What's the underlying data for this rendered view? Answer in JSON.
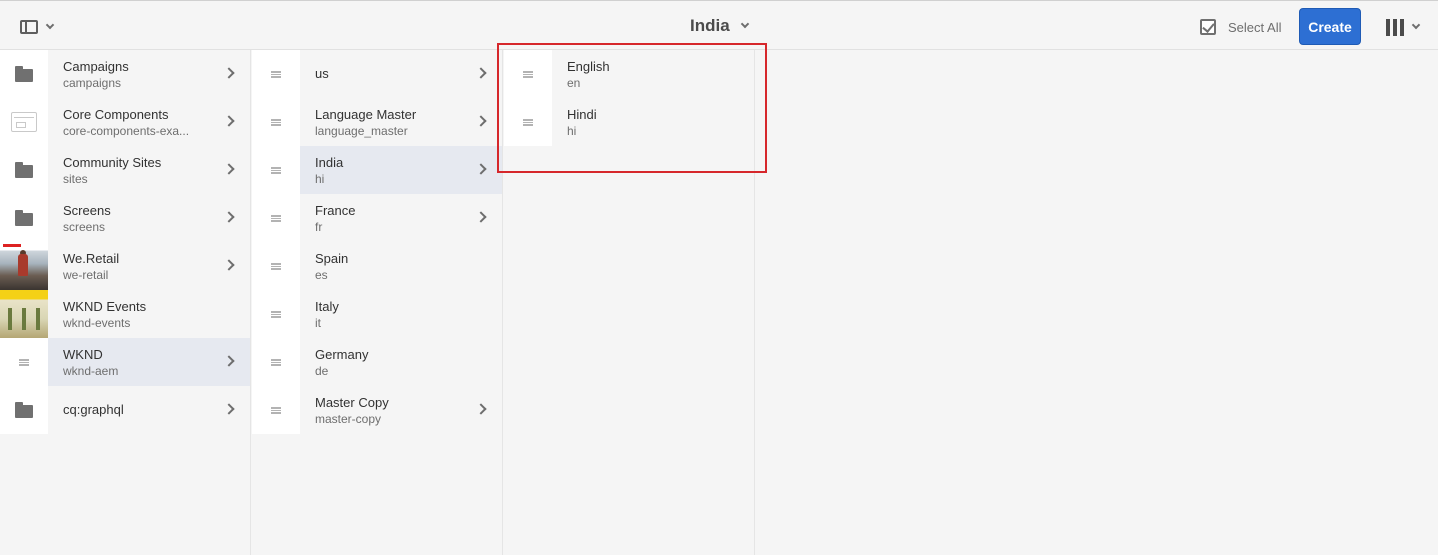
{
  "header": {
    "title": "India",
    "select_all_label": "Select All",
    "create_label": "Create"
  },
  "colors": {
    "accent": "#2d6fd3",
    "selection_bg": "#e6e9f0",
    "highlight_box": "#d6272b"
  },
  "columns": [
    {
      "items": [
        {
          "title": "Campaigns",
          "subtitle": "campaigns",
          "icon": "folder-icon",
          "has_children": true
        },
        {
          "title": "Core Components",
          "subtitle": "core-components-exa...",
          "icon": "component-thumbnail",
          "has_children": true
        },
        {
          "title": "Community Sites",
          "subtitle": "sites",
          "icon": "folder-icon",
          "has_children": true
        },
        {
          "title": "Screens",
          "subtitle": "screens",
          "icon": "folder-icon",
          "has_children": true
        },
        {
          "title": "We.Retail",
          "subtitle": "we-retail",
          "icon": "we-retail-thumbnail",
          "has_children": true
        },
        {
          "title": "WKND Events",
          "subtitle": "wknd-events",
          "icon": "wknd-events-thumbnail",
          "has_children": false
        },
        {
          "title": "WKND",
          "subtitle": "wknd-aem",
          "icon": "page-icon",
          "has_children": true,
          "selected": true
        },
        {
          "title": "cq:graphql",
          "subtitle": "",
          "icon": "folder-icon",
          "has_children": true
        }
      ]
    },
    {
      "items": [
        {
          "title": "us",
          "subtitle": "",
          "icon": "page-icon",
          "has_children": true
        },
        {
          "title": "Language Master",
          "subtitle": "language_master",
          "icon": "page-icon",
          "has_children": true
        },
        {
          "title": "India",
          "subtitle": "hi",
          "icon": "page-icon",
          "has_children": true,
          "selected": true
        },
        {
          "title": "France",
          "subtitle": "fr",
          "icon": "page-icon",
          "has_children": true
        },
        {
          "title": "Spain",
          "subtitle": "es",
          "icon": "page-icon",
          "has_children": false
        },
        {
          "title": "Italy",
          "subtitle": "it",
          "icon": "page-icon",
          "has_children": false
        },
        {
          "title": "Germany",
          "subtitle": "de",
          "icon": "page-icon",
          "has_children": false
        },
        {
          "title": "Master Copy",
          "subtitle": "master-copy",
          "icon": "page-icon",
          "has_children": true
        }
      ]
    },
    {
      "items": [
        {
          "title": "English",
          "subtitle": "en",
          "icon": "page-icon",
          "has_children": false
        },
        {
          "title": "Hindi",
          "subtitle": "hi",
          "icon": "page-icon",
          "has_children": false
        }
      ]
    }
  ]
}
